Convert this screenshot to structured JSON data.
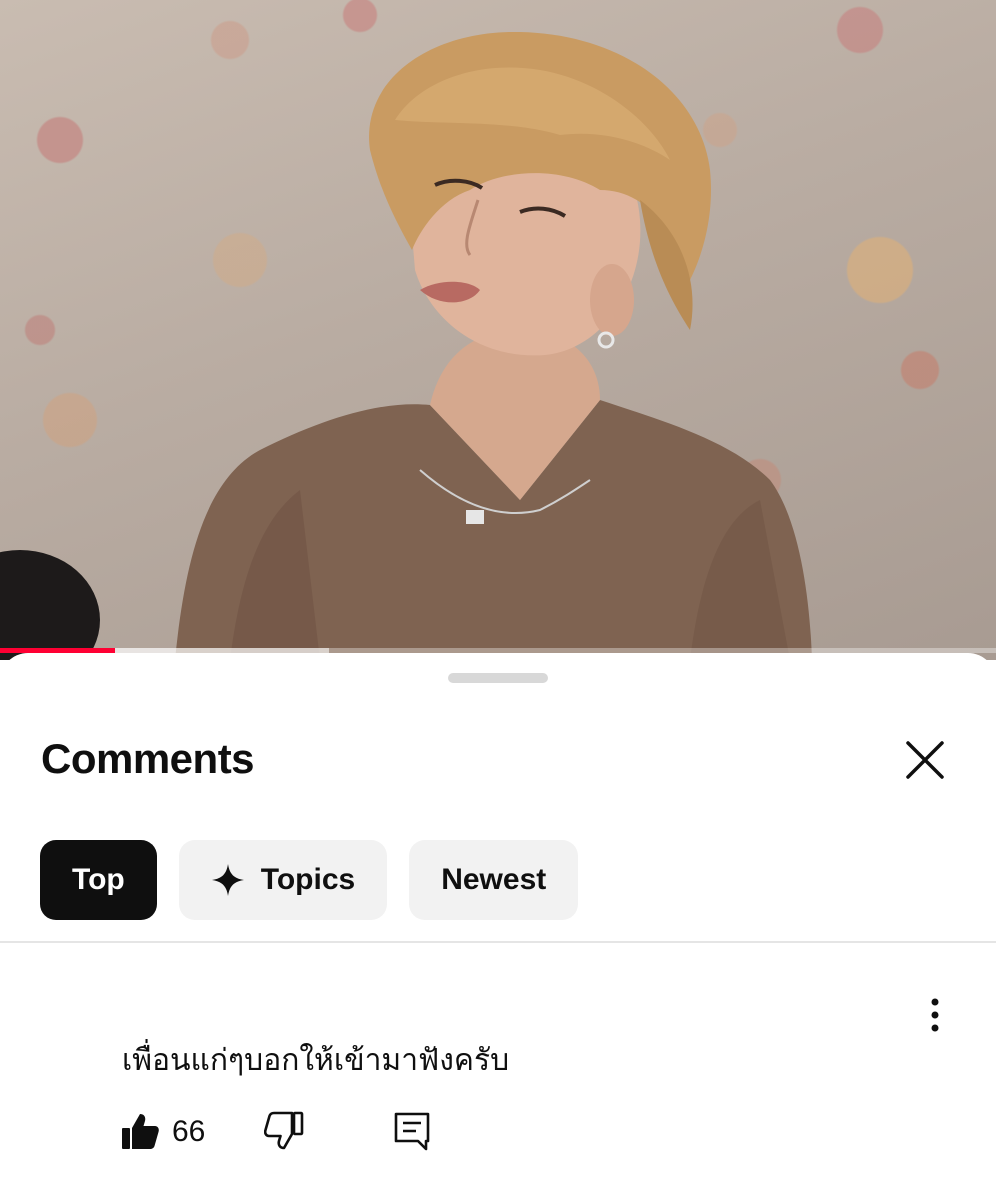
{
  "video": {
    "progress_played": 0.115,
    "progress_buffered": 0.33,
    "accent_color": "#ff0033"
  },
  "comments_panel": {
    "title": "Comments",
    "close_icon": "close-icon",
    "filters": [
      {
        "label": "Top",
        "active": true
      },
      {
        "label": "Topics",
        "icon": "sparkle-icon",
        "active": false
      },
      {
        "label": "Newest",
        "active": false
      }
    ]
  },
  "comment": {
    "text": "เพื่อนแก่ๆบอกให้เข้ามาฟังครับ",
    "likes": "66",
    "icons": [
      "thumbs-up-icon",
      "thumbs-down-icon",
      "reply-icon",
      "more-vert-icon"
    ]
  }
}
